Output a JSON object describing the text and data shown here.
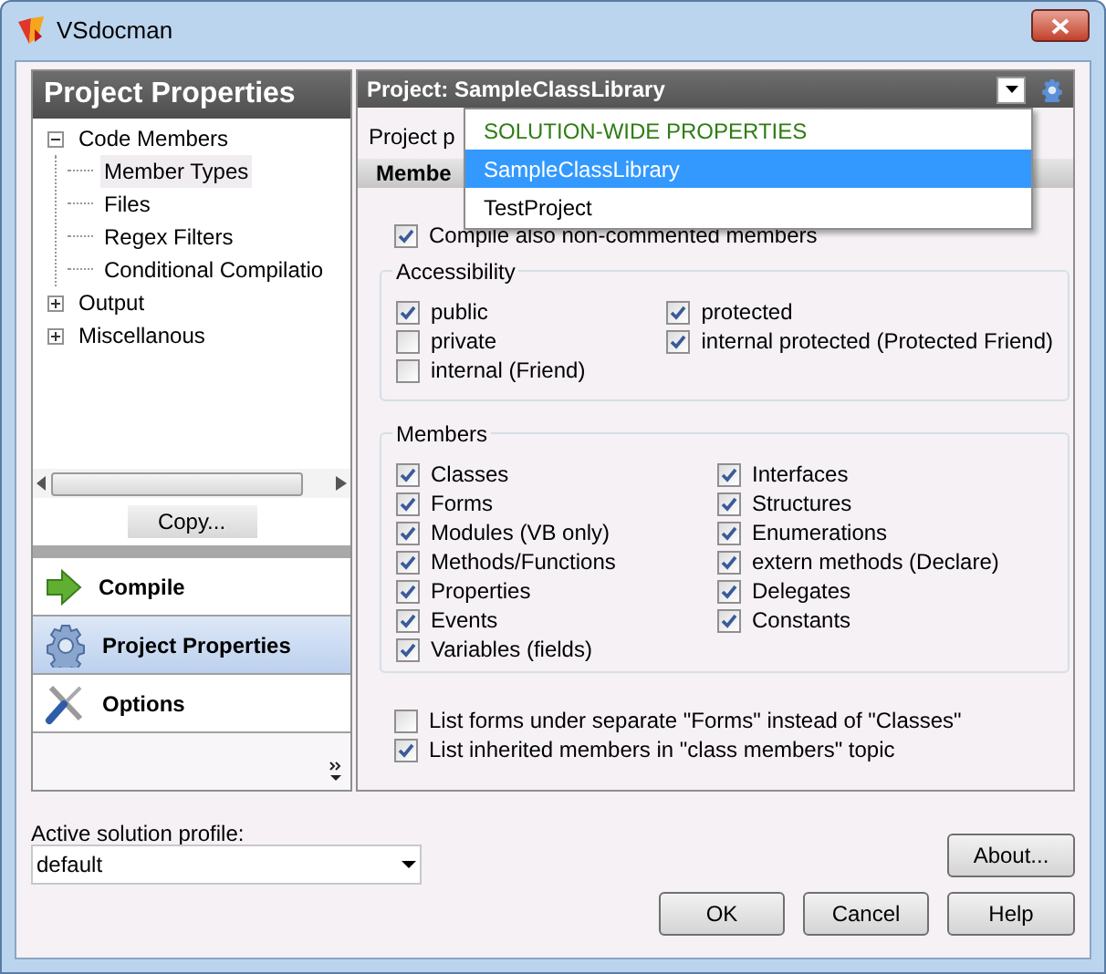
{
  "window": {
    "title": "VSdocman"
  },
  "left_panel": {
    "title": "Project Properties",
    "tree": [
      {
        "label": "Code Members",
        "expanded": true,
        "selected": false,
        "children": [
          {
            "label": "Member Types",
            "selected": true
          },
          {
            "label": "Files",
            "selected": false
          },
          {
            "label": "Regex Filters",
            "selected": false
          },
          {
            "label": "Conditional Compilatio",
            "selected": false
          }
        ]
      },
      {
        "label": "Output",
        "expanded": false,
        "selected": false
      },
      {
        "label": "Miscellanous",
        "expanded": false,
        "selected": false
      }
    ],
    "copy_button": "Copy...",
    "nav": [
      {
        "label": "Compile",
        "kind": "compile",
        "selected": false
      },
      {
        "label": "Project Properties",
        "kind": "properties",
        "selected": true
      },
      {
        "label": "Options",
        "kind": "options",
        "selected": false
      }
    ]
  },
  "right_panel": {
    "header": "Project: SampleClassLibrary",
    "dropdown_options": [
      {
        "label": "SOLUTION-WIDE PROPERTIES",
        "kind": "heading",
        "selected": false
      },
      {
        "label": "SampleClassLibrary",
        "kind": "project",
        "selected": true
      },
      {
        "label": "TestProject",
        "kind": "project",
        "selected": false
      }
    ],
    "caption": "Project p",
    "tab": "Membe",
    "compile_option": {
      "label": "Compile also non-commented members",
      "checked": true
    },
    "groups": [
      {
        "title": "Accessibility",
        "columns": [
          [
            {
              "label": "public",
              "checked": true
            },
            {
              "label": "private",
              "checked": false
            },
            {
              "label": "internal (Friend)",
              "checked": false
            }
          ],
          [
            {
              "label": "protected",
              "checked": true
            },
            {
              "label": "internal protected (Protected Friend)",
              "checked": true
            }
          ]
        ]
      },
      {
        "title": "Members",
        "columns": [
          [
            {
              "label": "Classes",
              "checked": true
            },
            {
              "label": "Forms",
              "checked": true
            },
            {
              "label": "Modules (VB only)",
              "checked": true
            },
            {
              "label": "Methods/Functions",
              "checked": true
            },
            {
              "label": "Properties",
              "checked": true
            },
            {
              "label": "Events",
              "checked": true
            },
            {
              "label": "Variables (fields)",
              "checked": true
            }
          ],
          [
            {
              "label": "Interfaces",
              "checked": true
            },
            {
              "label": "Structures",
              "checked": true
            },
            {
              "label": "Enumerations",
              "checked": true
            },
            {
              "label": "extern methods (Declare)",
              "checked": true
            },
            {
              "label": "Delegates",
              "checked": true
            },
            {
              "label": "Constants",
              "checked": true
            }
          ]
        ]
      }
    ],
    "list_options": [
      {
        "label": "List forms under separate \"Forms\" instead of \"Classes\"",
        "checked": false
      },
      {
        "label": "List inherited members in \"class members\" topic",
        "checked": true
      }
    ]
  },
  "profile": {
    "label": "Active solution profile:",
    "value": "default"
  },
  "buttons": {
    "about": "About...",
    "ok": "OK",
    "cancel": "Cancel",
    "help": "Help"
  }
}
